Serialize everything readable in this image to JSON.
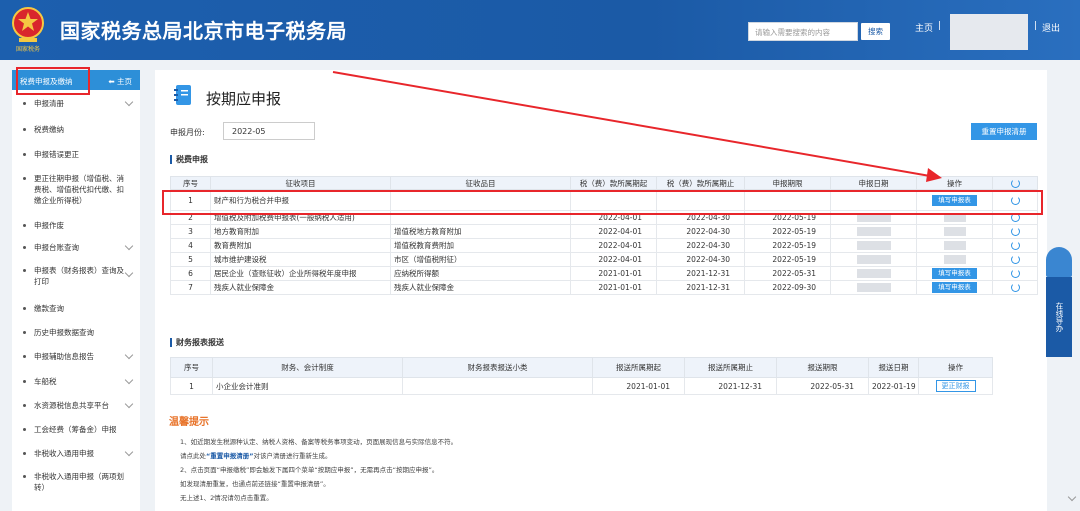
{
  "header": {
    "emblem_text": "国家税务",
    "title": "国家税务总局北京市电子税务局",
    "search_placeholder": "请输入需要搜索的内容",
    "search_btn": "搜索",
    "home": "主页",
    "sep": "|",
    "logout": "退出"
  },
  "sidebar": {
    "current": "税费申报及缴纳",
    "home_link": "⬅ 主页",
    "items": [
      {
        "label": "申报清册"
      },
      {
        "label": "税费缴纳"
      },
      {
        "label": "申报错误更正"
      },
      {
        "label": "更正往期申报（增值税、消费税、增值税代扣代缴、扣缴企业所得税）"
      },
      {
        "label": "申报作废"
      },
      {
        "label": "申报台账查询"
      },
      {
        "label": "申报表（财务报表）查询及打印"
      },
      {
        "label": "缴款查询"
      },
      {
        "label": "历史申报数据查询"
      },
      {
        "label": "申报辅助信息报告"
      },
      {
        "label": "车船税"
      },
      {
        "label": "水资源税信息共享平台"
      },
      {
        "label": "工会经费（筹备金）申报"
      },
      {
        "label": "非税收入通用申报"
      },
      {
        "label": "非税收入通用申报（两项划转）"
      }
    ]
  },
  "main": {
    "title": "按期应申报",
    "month_label": "申报月份:",
    "month_value": "2022-05",
    "reset_btn": "重置申报清册",
    "tax_section": "税费申报",
    "tax_headers": [
      "序号",
      "征收项目",
      "征收品目",
      "税（费）款所属期起",
      "税（费）款所属期止",
      "申报期限",
      "申报日期",
      "操作"
    ],
    "tax_rows": [
      {
        "no": "1",
        "item": "财产和行为税合并申报",
        "sub": "",
        "start": "",
        "end": "",
        "deadline": "",
        "date": "",
        "op": "填写申报表"
      },
      {
        "no": "2",
        "item": "增值税及附加税费申报表(一般纳税人适用)",
        "sub": "",
        "start": "2022-04-01",
        "end": "2022-04-30",
        "deadline": "2022-05-19",
        "date": "",
        "op": ""
      },
      {
        "no": "3",
        "item": "地方教育附加",
        "sub": "增值税地方教育附加",
        "start": "2022-04-01",
        "end": "2022-04-30",
        "deadline": "2022-05-19",
        "date": "",
        "op": ""
      },
      {
        "no": "4",
        "item": "教育费附加",
        "sub": "增值税教育费附加",
        "start": "2022-04-01",
        "end": "2022-04-30",
        "deadline": "2022-05-19",
        "date": "",
        "op": ""
      },
      {
        "no": "5",
        "item": "城市维护建设税",
        "sub": "市区（增值税附征）",
        "start": "2022-04-01",
        "end": "2022-04-30",
        "deadline": "2022-05-19",
        "date": "",
        "op": ""
      },
      {
        "no": "6",
        "item": "居民企业（查账征收）企业所得税年度申报",
        "sub": "应纳税所得额",
        "start": "2021-01-01",
        "end": "2021-12-31",
        "deadline": "2022-05-31",
        "date": "",
        "op": "填写申报表"
      },
      {
        "no": "7",
        "item": "残疾人就业保障金",
        "sub": "残疾人就业保障金",
        "start": "2021-01-01",
        "end": "2021-12-31",
        "deadline": "2022-09-30",
        "date": "",
        "op": "填写申报表"
      }
    ],
    "fin_section": "财务报表报送",
    "fin_headers": [
      "序号",
      "财务、会计制度",
      "财务报表报送小类",
      "报送所属期起",
      "报送所属期止",
      "报送期限",
      "报送日期",
      "操作"
    ],
    "fin_rows": [
      {
        "no": "1",
        "system": "小企业会计准则",
        "sub": "",
        "start": "2021-01-01",
        "end": "2021-12-31",
        "deadline": "2022-05-31",
        "date": "2022-01-19",
        "op": "更正财报"
      }
    ],
    "tips_title": "温馨提示",
    "tips": {
      "l1": "1、如近期发生税源种认定、纳税人资格、备案等税务事项变动，页面展现信息与实际信息不符。",
      "l2a": "请点此处",
      "l2b": "“重置申报清册”",
      "l2c": "对该户清册进行重新生成。",
      "l3": "2、点击页面“申报缴税”即会触发下属四个菜单“按期应申报”，无需再点击“按期应申报”。",
      "l4": "如发现清册重复，也通点前还链接“重置申报清册”。",
      "l5": "无上述1、2情况请勿点击重置。"
    }
  },
  "float_service": "在线导办",
  "colors": {
    "header": "#1b5aa6",
    "accent": "#3396e6",
    "highlight": "#e8262b",
    "tips_title": "#e8742b"
  }
}
